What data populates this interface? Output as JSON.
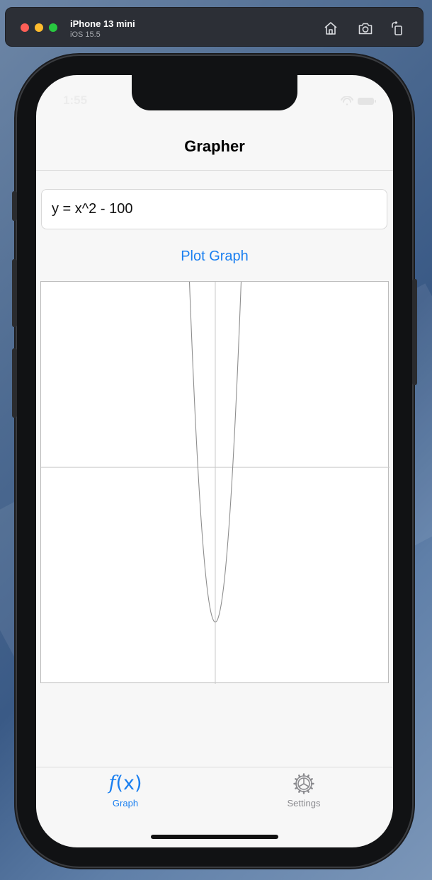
{
  "simulator": {
    "device_name": "iPhone 13 mini",
    "os_version": "iOS 15.5",
    "toolbar_icons": [
      "home-icon",
      "screenshot-icon",
      "rotate-icon"
    ]
  },
  "status_bar": {
    "time": "1:55",
    "icons": [
      "wifi-icon",
      "battery-icon"
    ]
  },
  "nav": {
    "title": "Grapher"
  },
  "equation": {
    "value": "y = x^2 - 100"
  },
  "plot_button": {
    "label": "Plot Graph"
  },
  "graph": {
    "curve_color": "#8e8e8e",
    "axis_color": "#c9c9c9",
    "xlim": [
      -100,
      100
    ],
    "ylim": [
      -140,
      120
    ],
    "function": "x^2 - 100"
  },
  "tabs": [
    {
      "label": "Graph",
      "icon": "function-icon",
      "selected": true
    },
    {
      "label": "Settings",
      "icon": "gear-icon",
      "selected": false
    }
  ],
  "colors": {
    "accent": "#1a7ff0",
    "inactive": "#8a8a8e"
  }
}
